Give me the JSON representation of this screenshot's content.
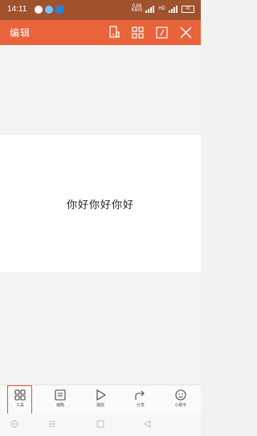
{
  "status_bar": {
    "time": "14:11",
    "net_speed": "0.69",
    "net_unit": "KB/S",
    "signal": "HD",
    "battery": "41"
  },
  "toolbar": {
    "title": "编辑",
    "actions": [
      "phone-icon",
      "grid-icon",
      "edit-icon",
      "close-icon"
    ]
  },
  "slide": {
    "text": "你好你好你好"
  },
  "bottom_bar": {
    "items": [
      {
        "label": "工具",
        "icon": "tools-icon",
        "selected": true
      },
      {
        "label": "缩略",
        "icon": "thumbnail-icon",
        "selected": false
      },
      {
        "label": "播放",
        "icon": "play-icon",
        "selected": false
      },
      {
        "label": "分享",
        "icon": "share-icon",
        "selected": false
      },
      {
        "label": "小助手",
        "icon": "assistant-icon",
        "selected": false
      }
    ]
  },
  "colors": {
    "status_bar": "#a0522d",
    "toolbar": "#e9633b",
    "selection": "#e0533c"
  }
}
